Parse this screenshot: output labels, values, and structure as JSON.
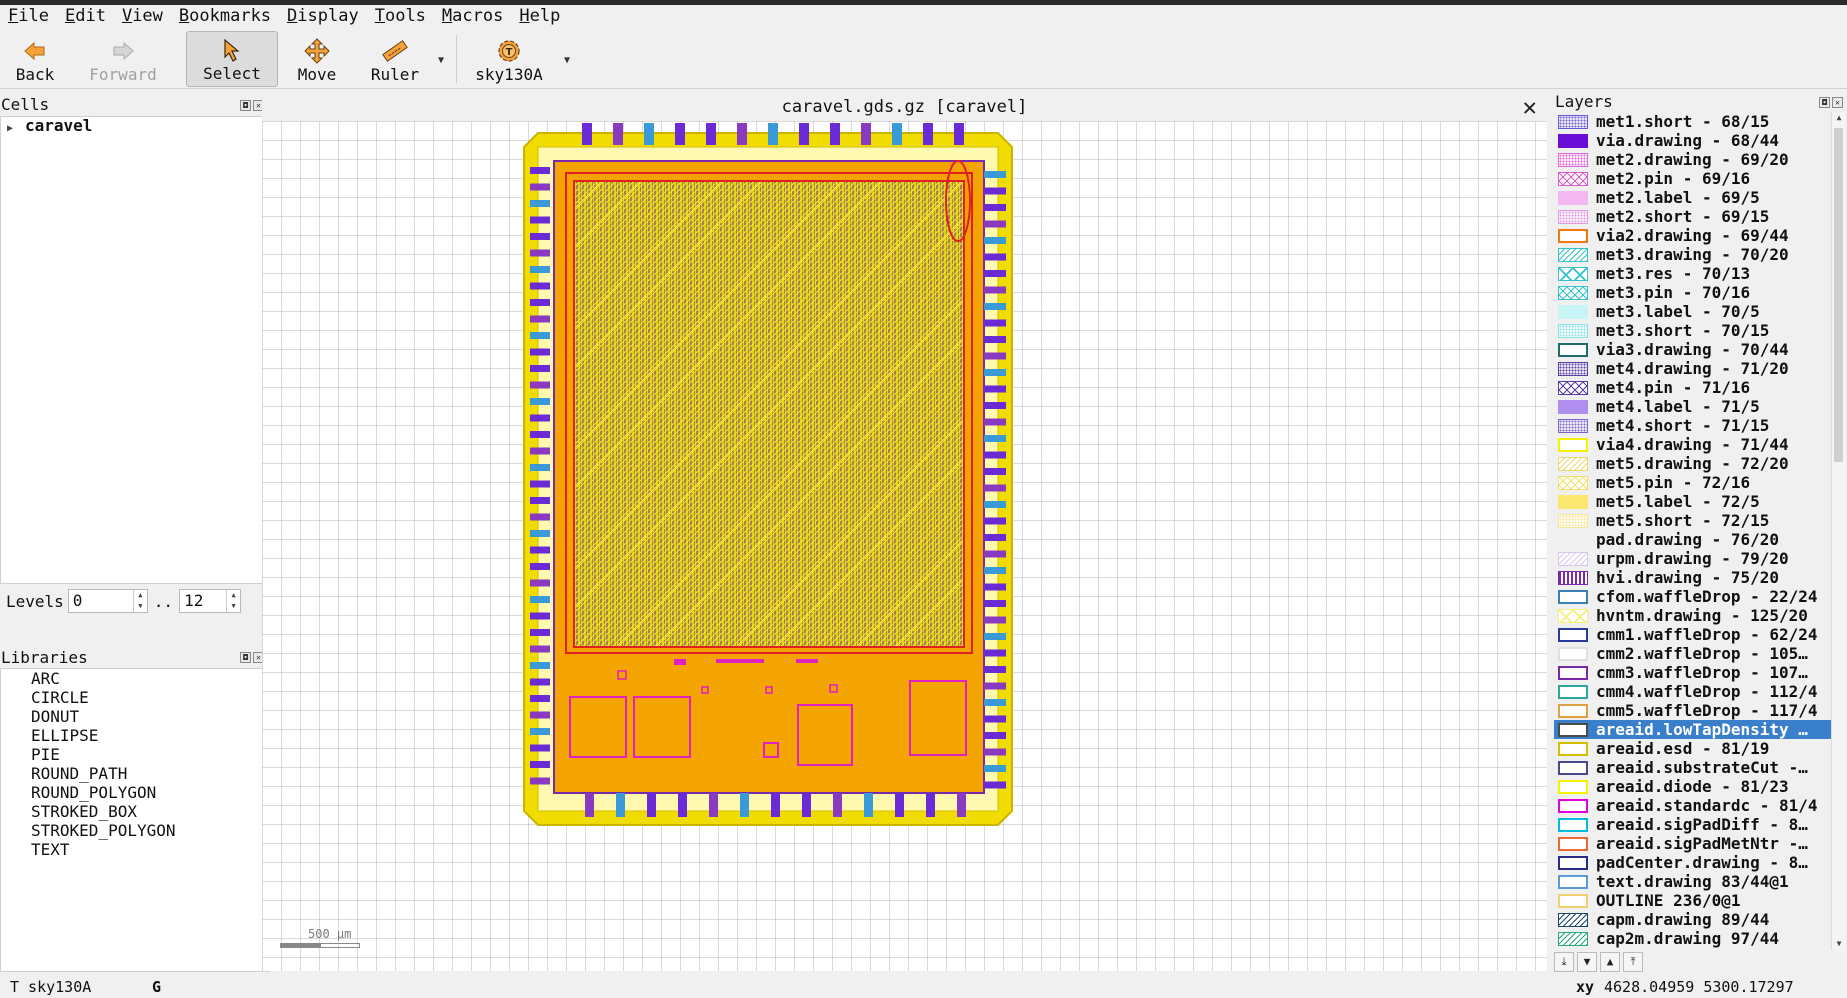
{
  "menu": [
    {
      "label": "File",
      "mnemonic": "F",
      "rest": "ile"
    },
    {
      "label": "Edit",
      "mnemonic": "E",
      "rest": "dit"
    },
    {
      "label": "View",
      "mnemonic": "V",
      "rest": "iew"
    },
    {
      "label": "Bookmarks",
      "mnemonic": "B",
      "rest": "ookmarks"
    },
    {
      "label": "Display",
      "mnemonic": "D",
      "rest": "isplay"
    },
    {
      "label": "Tools",
      "mnemonic": "T",
      "rest": "ools"
    },
    {
      "label": "Macros",
      "mnemonic": "M",
      "rest": "acros"
    },
    {
      "label": "Help",
      "mnemonic": "H",
      "rest": "elp"
    }
  ],
  "toolbar": {
    "back": "Back",
    "forward": "Forward",
    "select": "Select",
    "move": "Move",
    "ruler": "Ruler",
    "tech": "sky130A"
  },
  "cells": {
    "title": "Cells",
    "tree": [
      {
        "name": "caravel"
      }
    ]
  },
  "levels": {
    "label": "Levels",
    "from": "0",
    "sep": "..",
    "to": "12"
  },
  "libraries": {
    "title": "Libraries",
    "items": [
      "ARC",
      "CIRCLE",
      "DONUT",
      "ELLIPSE",
      "PIE",
      "ROUND_PATH",
      "ROUND_POLYGON",
      "STROKED_BOX",
      "STROKED_POLYGON",
      "TEXT"
    ]
  },
  "document": {
    "tab_title": "caravel.gds.gz [caravel]",
    "close": "✕"
  },
  "scalebar": {
    "label": "500 µm"
  },
  "layers": {
    "title": "Layers",
    "items": [
      {
        "name": "met1.short - 68/15",
        "color": "#6a5acd",
        "fill": "dots"
      },
      {
        "name": "via.drawing - 68/44",
        "color": "#6a0dd6",
        "fill": "solid"
      },
      {
        "name": "met2.drawing - 69/20",
        "color": "#e06bd8",
        "fill": "dots"
      },
      {
        "name": "met2.pin - 69/16",
        "color": "#d65ccf",
        "fill": "cross"
      },
      {
        "name": "met2.label - 69/5",
        "color": "#f2b8ef",
        "fill": "solid"
      },
      {
        "name": "met2.short - 69/15",
        "color": "#e39ae0",
        "fill": "dots"
      },
      {
        "name": "via2.drawing - 69/44",
        "color": "#f07a10",
        "fill": "outline"
      },
      {
        "name": "met3.drawing - 70/20",
        "color": "#34c3c9",
        "fill": "diag"
      },
      {
        "name": "met3.res - 70/13",
        "color": "#34c3c9",
        "fill": "x"
      },
      {
        "name": "met3.pin - 70/16",
        "color": "#34c3c9",
        "fill": "cross"
      },
      {
        "name": "met3.label - 70/5",
        "color": "#c8f4f6",
        "fill": "solid"
      },
      {
        "name": "met3.short - 70/15",
        "color": "#8ee0e4",
        "fill": "dots"
      },
      {
        "name": "via3.drawing - 70/44",
        "color": "#1d6b6b",
        "fill": "outline"
      },
      {
        "name": "met4.drawing - 71/20",
        "color": "#5a3fa0",
        "fill": "dots"
      },
      {
        "name": "met4.pin - 71/16",
        "color": "#5a3fa0",
        "fill": "cross"
      },
      {
        "name": "met4.label - 71/5",
        "color": "#b08ef0",
        "fill": "solid"
      },
      {
        "name": "met4.short - 71/15",
        "color": "#7a63c4",
        "fill": "dots"
      },
      {
        "name": "via4.drawing - 71/44",
        "color": "#f4f400",
        "fill": "outline"
      },
      {
        "name": "met5.drawing - 72/20",
        "color": "#e8d870",
        "fill": "diag"
      },
      {
        "name": "met5.pin - 72/16",
        "color": "#f0e070",
        "fill": "cross"
      },
      {
        "name": "met5.label - 72/5",
        "color": "#fbe670",
        "fill": "solid"
      },
      {
        "name": "met5.short - 72/15",
        "color": "#f5e69a",
        "fill": "dots"
      },
      {
        "name": "pad.drawing - 76/20",
        "color": "#ffffff",
        "fill": "none"
      },
      {
        "name": "urpm.drawing - 79/20",
        "color": "#d8c8f0",
        "fill": "diag"
      },
      {
        "name": "hvi.drawing - 75/20",
        "color": "#7a2aa8",
        "fill": "vlines"
      },
      {
        "name": "cfom.waffleDrop - 22/24",
        "color": "#3a7fb0",
        "fill": "outline"
      },
      {
        "name": "hvntm.drawing - 125/20",
        "color": "#f4f080",
        "fill": "x"
      },
      {
        "name": "cmm1.waffleDrop - 62/24",
        "color": "#2a3a9a",
        "fill": "outline"
      },
      {
        "name": "cmm2.waffleDrop - 105…",
        "color": "#e0e0e0",
        "fill": "outline"
      },
      {
        "name": "cmm3.waffleDrop - 107…",
        "color": "#7a2aa8",
        "fill": "outline"
      },
      {
        "name": "cmm4.waffleDrop - 112/4",
        "color": "#2aa8a0",
        "fill": "outline"
      },
      {
        "name": "cmm5.waffleDrop - 117/4",
        "color": "#e0a040",
        "fill": "outline"
      },
      {
        "name": "areaid.lowTapDensity …",
        "color": "#4a4a4a",
        "fill": "outline",
        "selected": true
      },
      {
        "name": "areaid.esd - 81/19",
        "color": "#d4c000",
        "fill": "outline"
      },
      {
        "name": "areaid.substrateCut -…",
        "color": "#4a4a8a",
        "fill": "outline"
      },
      {
        "name": "areaid.diode - 81/23",
        "color": "#f4f400",
        "fill": "outline"
      },
      {
        "name": "areaid.standardc - 81/4",
        "color": "#e000e0",
        "fill": "outline"
      },
      {
        "name": "areaid.sigPadDiff - 8…",
        "color": "#00b8e0",
        "fill": "outline"
      },
      {
        "name": "areaid.sigPadMetNtr -…",
        "color": "#e86a3a",
        "fill": "outline"
      },
      {
        "name": "padCenter.drawing - 8…",
        "color": "#2a2a8a",
        "fill": "outline"
      },
      {
        "name": "text.drawing 83/44@1",
        "color": "#5a9ad8",
        "fill": "outline"
      },
      {
        "name": "OUTLINE 236/0@1",
        "color": "#f0d070",
        "fill": "outline"
      },
      {
        "name": "capm.drawing 89/44",
        "color": "#1d4a6b",
        "fill": "diag"
      },
      {
        "name": "cap2m.drawing 97/44",
        "color": "#2aa880",
        "fill": "diag"
      }
    ]
  },
  "status": {
    "tech": "T sky130A",
    "mode": "G",
    "coord_label": "xy",
    "coord": "4628.04959 5300.17297"
  }
}
